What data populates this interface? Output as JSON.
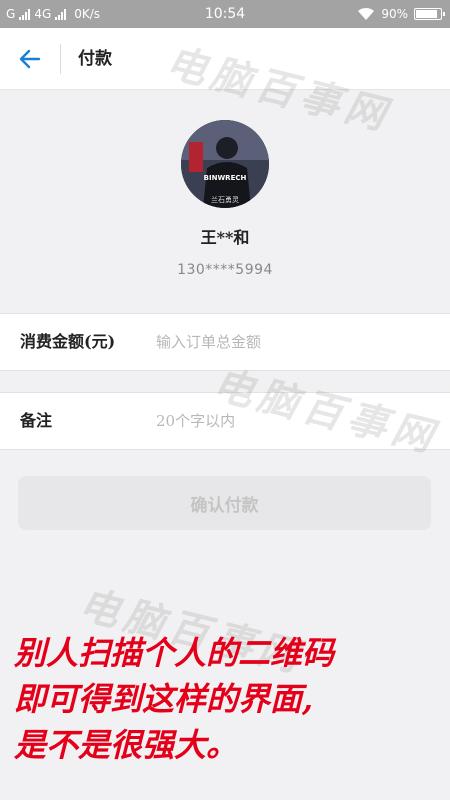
{
  "status_bar": {
    "carrier_1": "G",
    "carrier_2": "4G",
    "speed": "0K/s",
    "time": "10:54",
    "battery_text": "90%",
    "battery_level": 0.9
  },
  "nav": {
    "title": "付款"
  },
  "profile": {
    "avatar_text": "BINWRECH",
    "avatar_caption": "兰石勇灵",
    "name": "王**和",
    "phone": "130****5994"
  },
  "form": {
    "amount_label": "消费金额(元)",
    "amount_placeholder": "输入订单总金额",
    "note_label": "备注",
    "note_placeholder": "20个字以内"
  },
  "confirm_label": "确认付款",
  "watermark": "电脑百事网",
  "caption": {
    "line1": "别人扫描个人的二维码",
    "line2": "即可得到这样的界面,",
    "line3": "是不是很强大。"
  },
  "colors": {
    "accent": "#1a7fd6",
    "caption": "#e5001a",
    "status_bar": "#a3a3a3"
  }
}
